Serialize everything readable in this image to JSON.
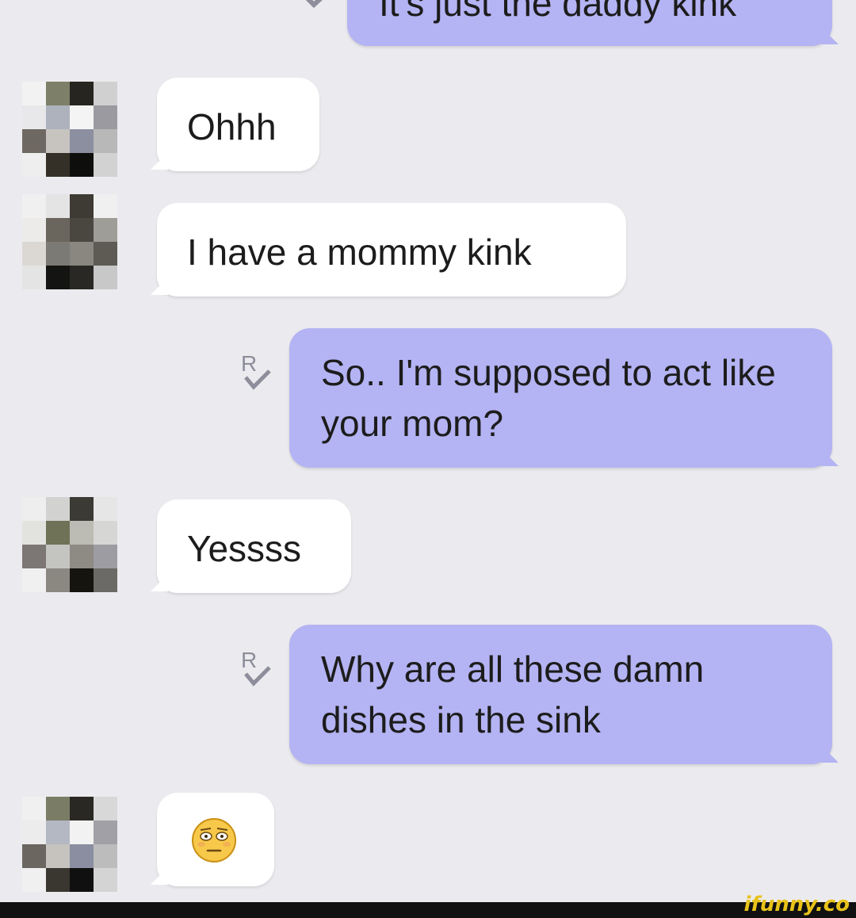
{
  "messages": [
    {
      "from": "me",
      "text": "It's just the daddy kink"
    },
    {
      "from": "them",
      "text": "Ohhh"
    },
    {
      "from": "them",
      "text": "I have a mommy kink"
    },
    {
      "from": "me",
      "text": "So.. I'm supposed to act like your mom?"
    },
    {
      "from": "them",
      "text": "Yessss"
    },
    {
      "from": "me",
      "text": "Why are all these damn dishes in the sink"
    },
    {
      "from": "them",
      "emoji": "flushed-face-icon"
    }
  ],
  "watermark": "ifunny.co",
  "colors": {
    "background": "#ebebef",
    "outgoing_bubble": "#b4b3f3",
    "incoming_bubble": "#ffffff",
    "watermark": "#e8c21a"
  }
}
